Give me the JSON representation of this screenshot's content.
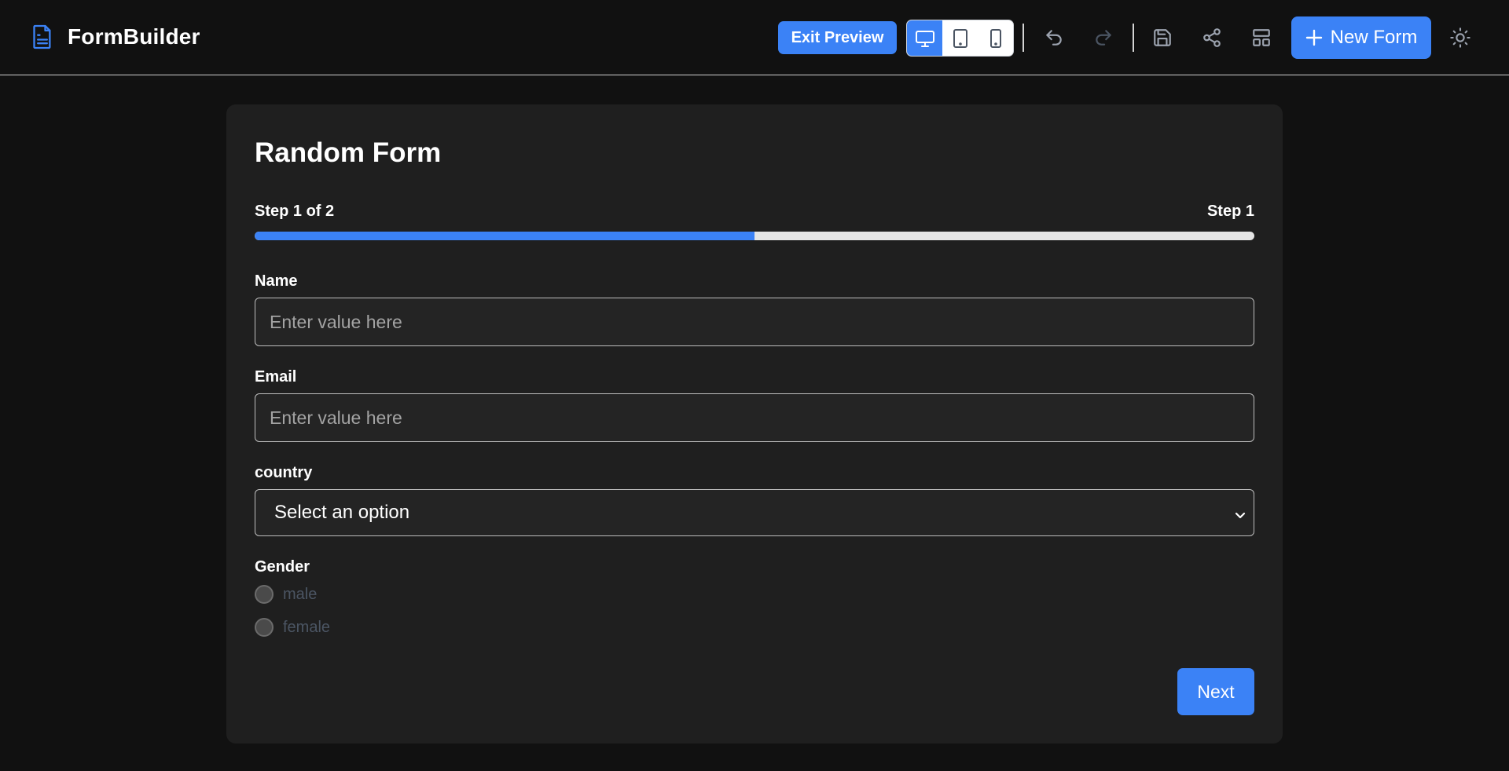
{
  "app": {
    "name": "FormBuilder",
    "accent_color": "#3b82f6"
  },
  "toolbar": {
    "exit_preview_label": "Exit Preview",
    "devices": [
      {
        "icon": "desktop-icon",
        "active": true
      },
      {
        "icon": "tablet-icon",
        "active": false
      },
      {
        "icon": "mobile-icon",
        "active": false
      }
    ],
    "actions": [
      "undo-icon",
      "redo-icon",
      "save-icon",
      "share-icon",
      "layout-icon"
    ],
    "new_form_label": "New Form",
    "theme_icon": "sun-icon"
  },
  "form": {
    "title": "Random Form",
    "step_text": "Step 1 of 2",
    "step_name": "Step 1",
    "progress": 0.5,
    "fields": {
      "name": {
        "label": "Name",
        "placeholder": "Enter value here"
      },
      "email": {
        "label": "Email",
        "placeholder": "Enter value here"
      },
      "country": {
        "label": "country",
        "selected": "Select an option"
      },
      "gender": {
        "label": "Gender",
        "options": [
          "male",
          "female"
        ]
      }
    },
    "next_label": "Next"
  }
}
